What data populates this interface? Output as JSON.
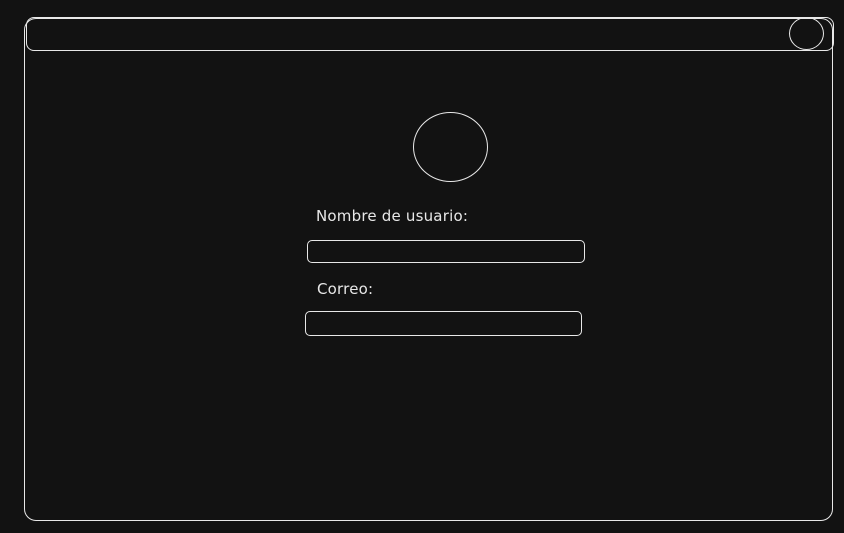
{
  "form": {
    "username": {
      "label": "Nombre de usuario:",
      "value": "",
      "placeholder": ""
    },
    "email": {
      "label": "Correo:",
      "value": "",
      "placeholder": ""
    }
  },
  "icons": {
    "window_button": "circle-button-icon",
    "avatar": "avatar-circle"
  },
  "colors": {
    "background": "#121212",
    "stroke": "#e8e8e8"
  }
}
